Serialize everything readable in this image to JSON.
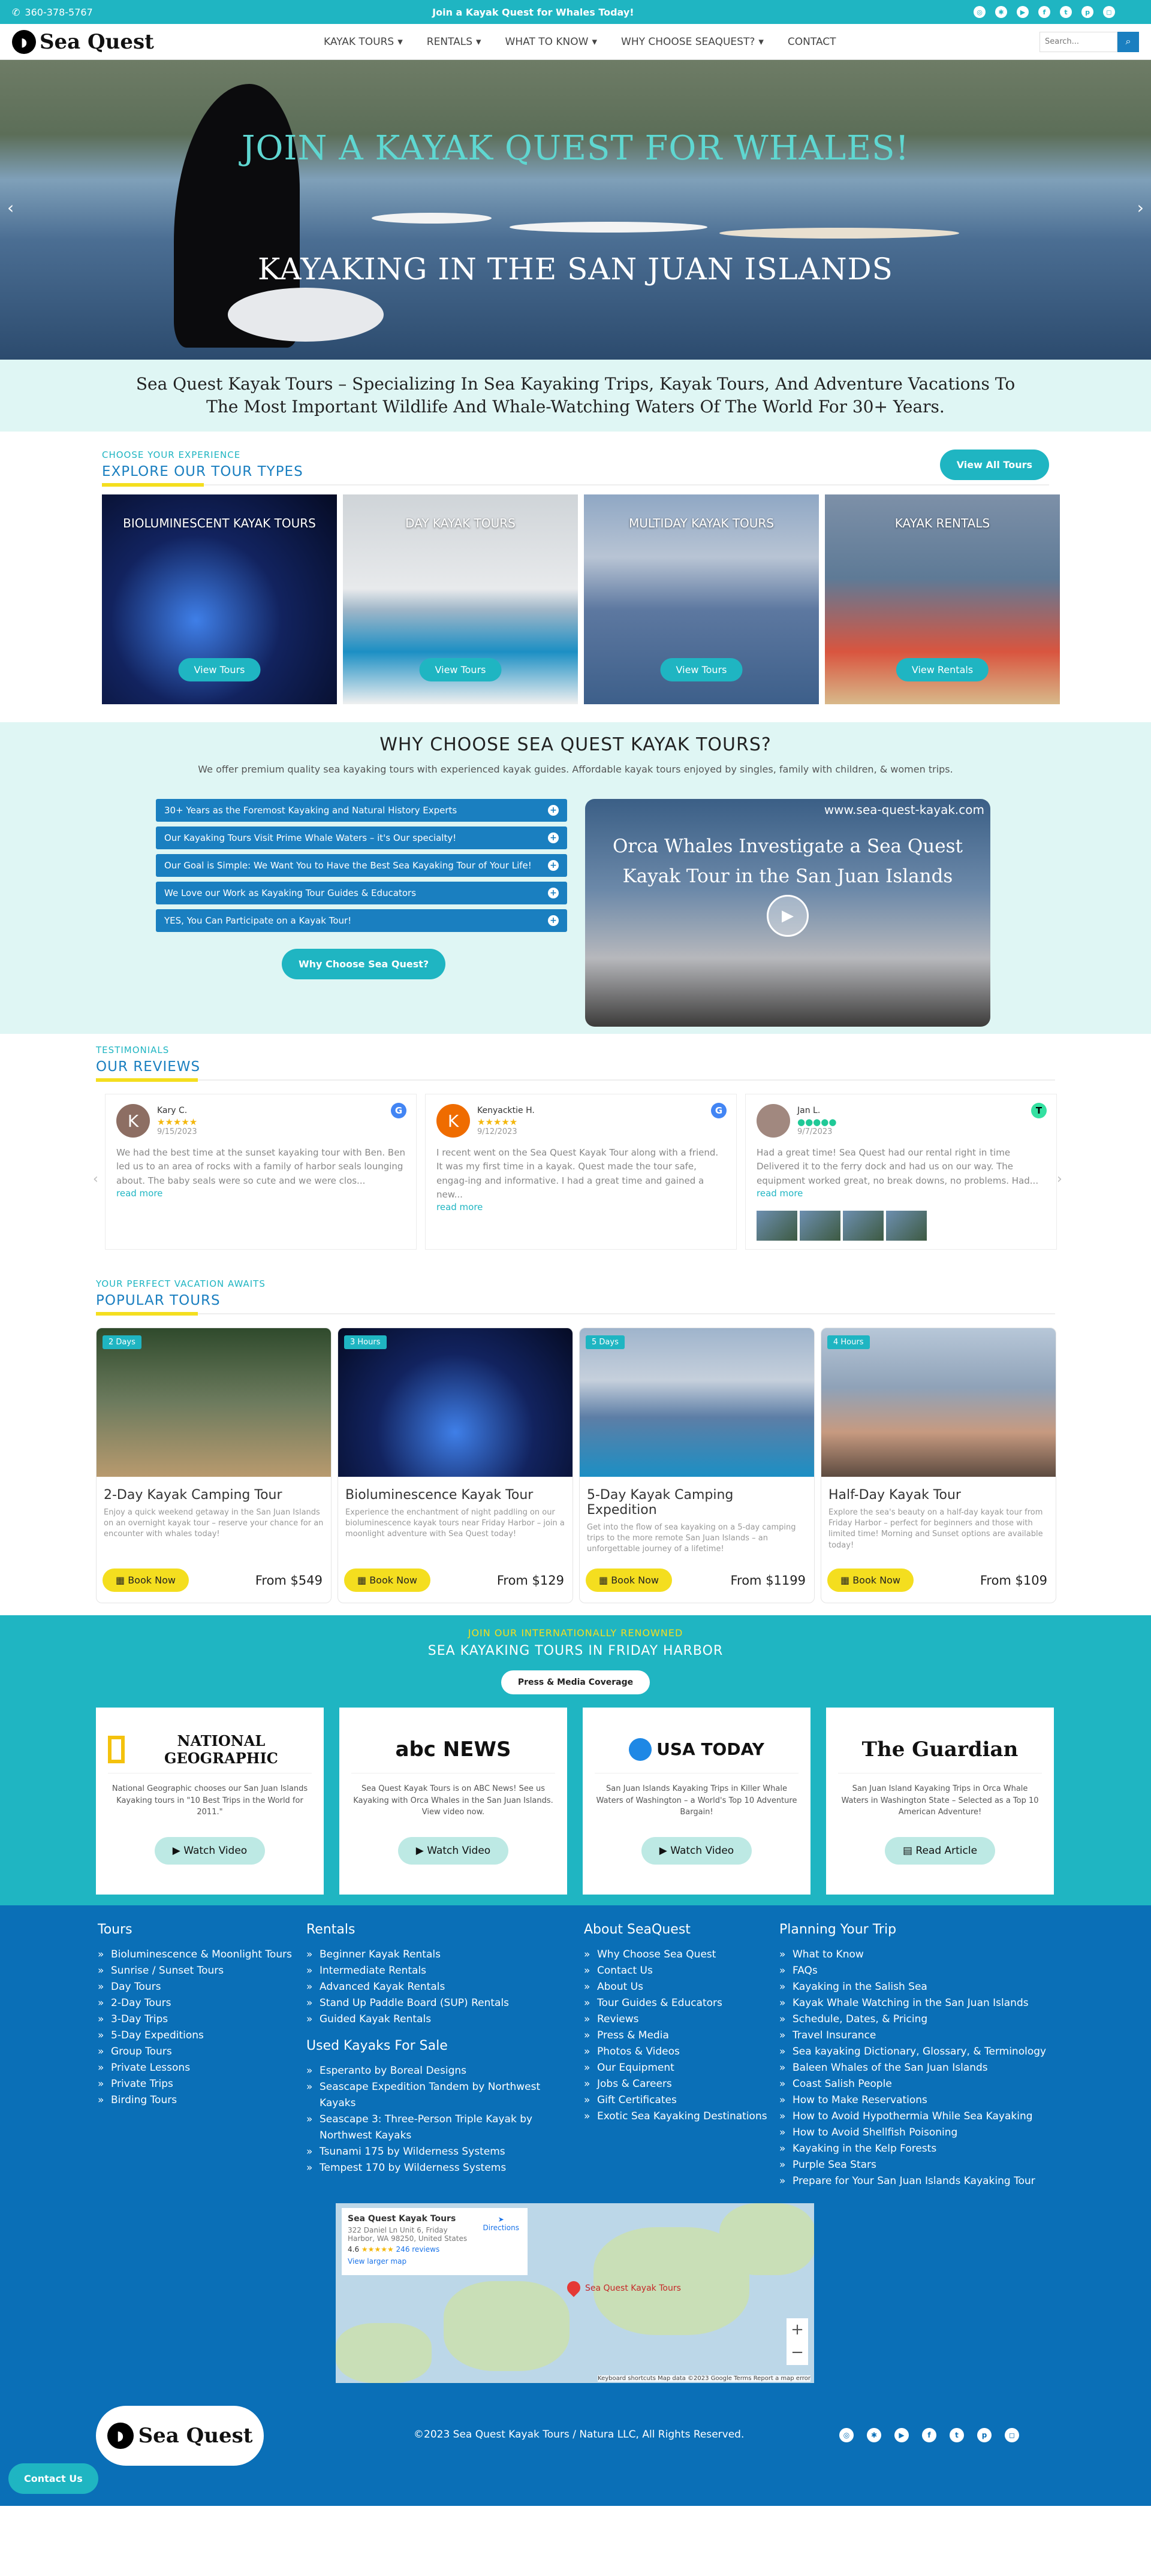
{
  "topbar": {
    "phone": "360-378-5767",
    "promo": "Join a Kayak Quest for Whales Today!",
    "social_icons": [
      "tripadvisor-icon",
      "yelp-icon",
      "youtube-icon",
      "facebook-icon",
      "twitter-icon",
      "pinterest-icon",
      "instagram-icon"
    ]
  },
  "nav": {
    "brand": "Sea Quest",
    "items": [
      "KAYAK TOURS",
      "RENTALS",
      "WHAT TO KNOW",
      "WHY CHOOSE SEAQUEST?",
      "CONTACT"
    ],
    "search_placeholder": "Search..."
  },
  "hero": {
    "headline": "JOIN A KAYAK QUEST FOR WHALES!",
    "subheadline": "KAYAKING IN THE SAN JUAN ISLANDS"
  },
  "tagline": "Sea Quest Kayak Tours – Specializing In Sea Kayaking Trips, Kayak Tours, And Adventure Vacations To The Most Important Wildlife And Whale-Watching Waters Of The World For 30+ Years.",
  "tour_types": {
    "kicker": "CHOOSE YOUR EXPERIENCE",
    "title": "EXPLORE OUR TOUR TYPES",
    "view_all": "View All Tours",
    "cards": [
      {
        "title": "BIOLUMINESCENT KAYAK TOURS",
        "button": "View Tours"
      },
      {
        "title": "DAY KAYAK TOURS",
        "button": "View Tours"
      },
      {
        "title": "MULTIDAY KAYAK TOURS",
        "button": "View Tours"
      },
      {
        "title": "KAYAK RENTALS",
        "button": "View Rentals"
      }
    ]
  },
  "why": {
    "title": "WHY CHOOSE SEA QUEST KAYAK TOURS?",
    "subtitle": "We offer premium quality sea kayaking tours with experienced kayak guides. Affordable kayak tours enjoyed by singles, family with children, & women trips.",
    "items": [
      "30+ Years as the Foremost Kayaking and Natural History Experts",
      "Our Kayaking Tours Visit Prime Whale Waters – it's Our specialty!",
      "Our Goal is Simple: We Want You to Have the Best Sea Kayaking Tour of Your Life!",
      "We Love our Work as Kayaking Tour Guides & Educators",
      "YES, You Can Participate on a Kayak Tour!"
    ],
    "button": "Why Choose Sea Quest?",
    "video_url": "www.sea-quest-kayak.com",
    "video_title": "Orca Whales Investigate a Sea Quest Kayak Tour in the San Juan Islands"
  },
  "reviews": {
    "kicker": "TESTIMONIALS",
    "title": "OUR REVIEWS",
    "items": [
      {
        "initial": "K",
        "name": "Kary C.",
        "stars": "★★★★★",
        "date": "9/15/2023",
        "source": "G",
        "text": "We had the best time at the sunset kayaking tour with Ben. Ben led us to an area of rocks with a family of harbor seals lounging about. The baby seals were so cute and we were clos...",
        "more": "read more",
        "color": "#8d6e63"
      },
      {
        "initial": "K",
        "name": "Kenyacktie H.",
        "stars": "★★★★★",
        "date": "9/12/2023",
        "source": "G",
        "text": "I recent went on the Sea Quest Kayak Tour along with a friend. It was my first time in a kayak. Quest made the tour safe, engag-ing and informative. I had a great time and gained a new...",
        "more": "read more",
        "color": "#ef6c00"
      },
      {
        "initial": "",
        "name": "Jan L.",
        "stars": "●●●●●",
        "date": "9/7/2023",
        "source": "T",
        "text": "Had a great time! Sea Quest had our rental right in time Delivered it to the ferry dock and had us on our way. The equipment worked great, no break downs, no problems. Had...",
        "more": "read more",
        "color": "#a1887f"
      }
    ]
  },
  "popular": {
    "kicker": "YOUR PERFECT VACATION AWAITS",
    "title": "POPULAR TOURS",
    "items": [
      {
        "tag": "2 Days",
        "title": "2-Day Kayak Camping Tour",
        "desc": "Enjoy a quick weekend getaway in the San Juan Islands on an overnight kayak tour – reserve your chance for an encounter with whales today!",
        "book": "Book Now",
        "price": "From $549"
      },
      {
        "tag": "3 Hours",
        "title": "Bioluminescence Kayak Tour",
        "desc": "Experience the enchantment of night paddling on our bioluminescence kayak tours near Friday Harbor – join a moonlight adventure with Sea Quest today!",
        "book": "Book Now",
        "price": "From $129"
      },
      {
        "tag": "5 Days",
        "title": "5-Day Kayak Camping Expedition",
        "desc": "Get into the flow of sea kayaking on a 5-day camping trips to the more remote San Juan Islands – an unforgettable journey of a lifetime!",
        "book": "Book Now",
        "price": "From $1199"
      },
      {
        "tag": "4 Hours",
        "title": "Half-Day Kayak Tour",
        "desc": "Explore the sea's beauty on a half-day kayak tour from Friday Harbor – perfect for beginners and those with limited time! Morning and Sunset options are available today!",
        "book": "Book Now",
        "price": "From $109"
      }
    ]
  },
  "press": {
    "kicker": "JOIN OUR INTERNATIONALLY RENOWNED",
    "title": "SEA KAYAKING TOURS IN FRIDAY HARBOR",
    "button": "Press & Media Coverage",
    "items": [
      {
        "logo": "NATIONAL GEOGRAPHIC",
        "text": "National Geographic chooses our San Juan Islands Kayaking tours in \"10 Best Trips in the World for 2011.\"",
        "button": "Watch Video"
      },
      {
        "logo": "abc NEWS",
        "text": "Sea Quest Kayak Tours is on ABC News! See us Kayaking with Orca Whales in the San Juan Islands. View video now.",
        "button": "Watch Video"
      },
      {
        "logo": "USA TODAY",
        "text": "San Juan Islands Kayaking Trips in Killer Whale Waters of Washington – a World's Top 10 Adventure Bargain!",
        "button": "Watch Video"
      },
      {
        "logo": "The Guardian",
        "text": "San Juan Island Kayaking Trips in Orca Whale Waters in Washington State – Selected as a Top 10 American Adventure!",
        "button": "Read Article"
      }
    ]
  },
  "footer": {
    "tours": {
      "title": "Tours",
      "items": [
        "Bioluminescence & Moonlight Tours",
        "Sunrise / Sunset Tours",
        "Day Tours",
        "2-Day Tours",
        "3-Day Trips",
        "5-Day Expeditions",
        "Group Tours",
        "Private Lessons",
        "Private Trips",
        "Birding Tours"
      ]
    },
    "rentals": {
      "title": "Rentals",
      "items": [
        "Beginner Kayak Rentals",
        "Intermediate Rentals",
        "Advanced Kayak Rentals",
        "Stand Up Paddle Board (SUP) Rentals",
        "Guided Kayak Rentals"
      ]
    },
    "used": {
      "title": "Used Kayaks For Sale",
      "items": [
        "Esperanto by Boreal Designs",
        "Seascape Expedition Tandem by Northwest Kayaks",
        "Seascape 3: Three-Person Triple Kayak by Northwest Kayaks",
        "Tsunami 175 by Wilderness Systems",
        "Tempest 170 by Wilderness Systems"
      ]
    },
    "about": {
      "title": "About SeaQuest",
      "items": [
        "Why Choose Sea Quest",
        "Contact Us",
        "About Us",
        "Tour Guides & Educators",
        "Reviews",
        "Press & Media",
        "Photos & Videos",
        "Our Equipment",
        "Jobs & Careers",
        "Gift Certificates",
        "Exotic Sea Kayaking Destinations"
      ]
    },
    "planning": {
      "title": "Planning Your Trip",
      "items": [
        "What to Know",
        "FAQs",
        "Kayaking in the Salish Sea",
        "Kayak Whale Watching in the San Juan Islands",
        "Schedule, Dates, & Pricing",
        "Travel Insurance",
        "Sea kayaking Dictionary, Glossary, & Terminology",
        "Baleen Whales of the San Juan Islands",
        "Coast Salish People",
        "How to Make Reservations",
        "How to Avoid Hypothermia While Sea Kayaking",
        "How to Avoid Shellfish Poisoning",
        "Kayaking in the Kelp Forests",
        "Purple Sea Stars",
        "Prepare for Your San Juan Islands Kayaking Tour"
      ]
    },
    "map": {
      "place": "Sea Quest Kayak Tours",
      "address": "322 Daniel Ln Unit 6, Friday Harbor, WA 98250, United States",
      "rating": "4.6",
      "reviews": "246 reviews",
      "directions": "Directions",
      "larger": "View larger map",
      "pin_label": "Sea Quest Kayak Tours",
      "attribution": "Keyboard shortcuts   Map data ©2023 Google   Terms   Report a map error"
    },
    "copyright": "©2023 Sea Quest Kayak Tours / Natura LLC, All Rights Reserved.",
    "contact": "Contact Us"
  }
}
